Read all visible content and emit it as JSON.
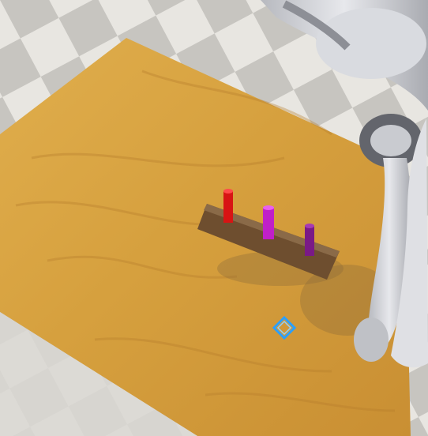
{
  "scene": {
    "description_free": true,
    "colors": {
      "floor_light": "#e6e4df",
      "floor_dark": "#b9b7b2",
      "table_wood": "#d9a441",
      "table_wood_dark": "#b97f2b",
      "peg_board": "#6e4e2f",
      "peg_red": "#d81414",
      "peg_magenta": "#c020c8",
      "peg_purple": "#7a1a86",
      "robot_light": "#d8dadf",
      "robot_dark": "#7d7f86",
      "target_marker": "#2aa0ff"
    },
    "objects": [
      {
        "name": "wooden-table"
      },
      {
        "name": "peg-board"
      },
      {
        "name": "red-peg"
      },
      {
        "name": "magenta-peg"
      },
      {
        "name": "purple-peg"
      },
      {
        "name": "robot-arm"
      },
      {
        "name": "target-marker"
      }
    ]
  }
}
